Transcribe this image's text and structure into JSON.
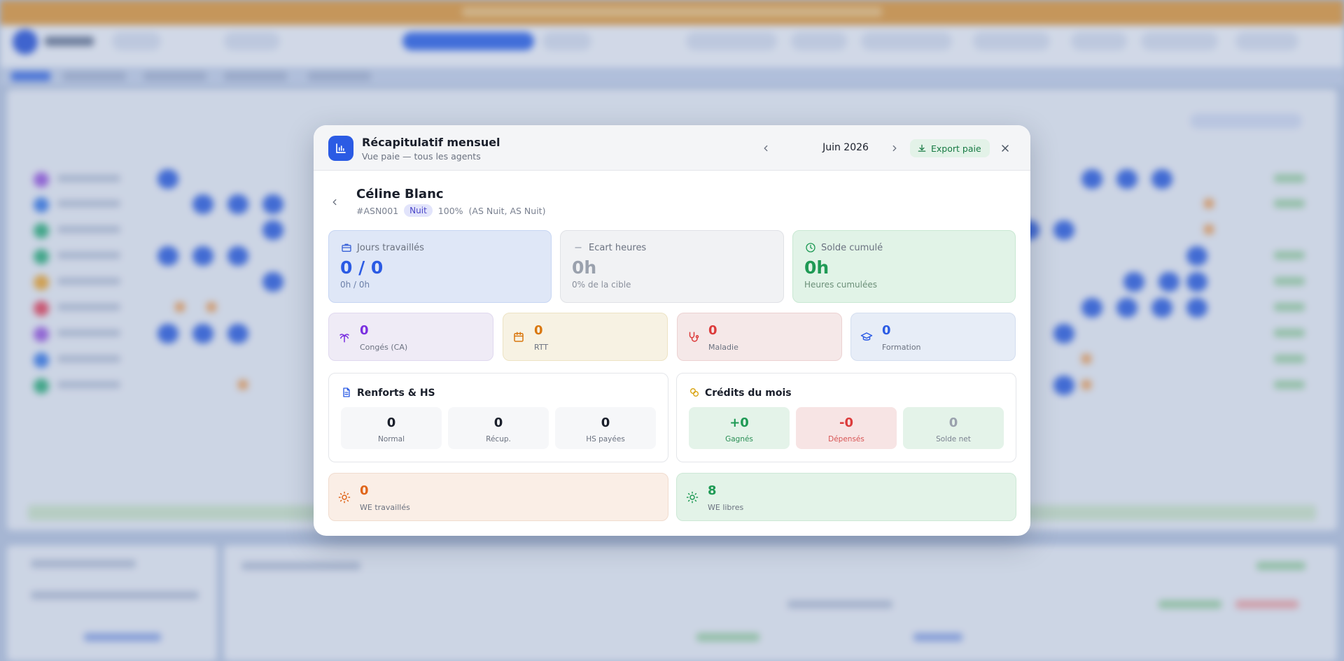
{
  "modal": {
    "title": "Récapitulatif mensuel",
    "subtitle": "Vue paie — tous les agents",
    "month": "Juin 2026",
    "export_label": "Export paie"
  },
  "employee": {
    "name": "Céline Blanc",
    "id": "#ASN001",
    "badge": "Nuit",
    "rate": "100%",
    "roles": "(AS Nuit, AS Nuit)"
  },
  "stats": {
    "jours": {
      "label": "Jours travaillés",
      "value": "0 / 0",
      "sub": "0h / 0h"
    },
    "ecart": {
      "label": "Ecart heures",
      "value": "0h",
      "sub": "0% de la cible"
    },
    "solde": {
      "label": "Solde cumulé",
      "value": "0h",
      "sub": "Heures cumulées"
    }
  },
  "absences": [
    {
      "value": "0",
      "label": "Congés (CA)",
      "icon": "palm-tree-icon"
    },
    {
      "value": "0",
      "label": "RTT",
      "icon": "calendar-icon"
    },
    {
      "value": "0",
      "label": "Maladie",
      "icon": "stethoscope-icon"
    },
    {
      "value": "0",
      "label": "Formation",
      "icon": "graduation-cap-icon"
    }
  ],
  "renforts": {
    "title": "Renforts & HS",
    "tiles": [
      {
        "value": "0",
        "label": "Normal"
      },
      {
        "value": "0",
        "label": "Récup."
      },
      {
        "value": "0",
        "label": "HS payées"
      }
    ]
  },
  "credits": {
    "title": "Crédits du mois",
    "tiles": [
      {
        "value": "+0",
        "label": "Gagnés"
      },
      {
        "value": "-0",
        "label": "Dépensés"
      },
      {
        "value": "0",
        "label": "Solde net"
      }
    ]
  },
  "weekends": {
    "worked": {
      "value": "0",
      "label": "WE travaillés"
    },
    "free": {
      "value": "8",
      "label": "WE libres"
    }
  },
  "colors": {
    "accent": "#2b5be4",
    "green": "#177a43",
    "purple": "#7a2fe0",
    "orange": "#d9770f",
    "red": "#dc3b3b"
  }
}
